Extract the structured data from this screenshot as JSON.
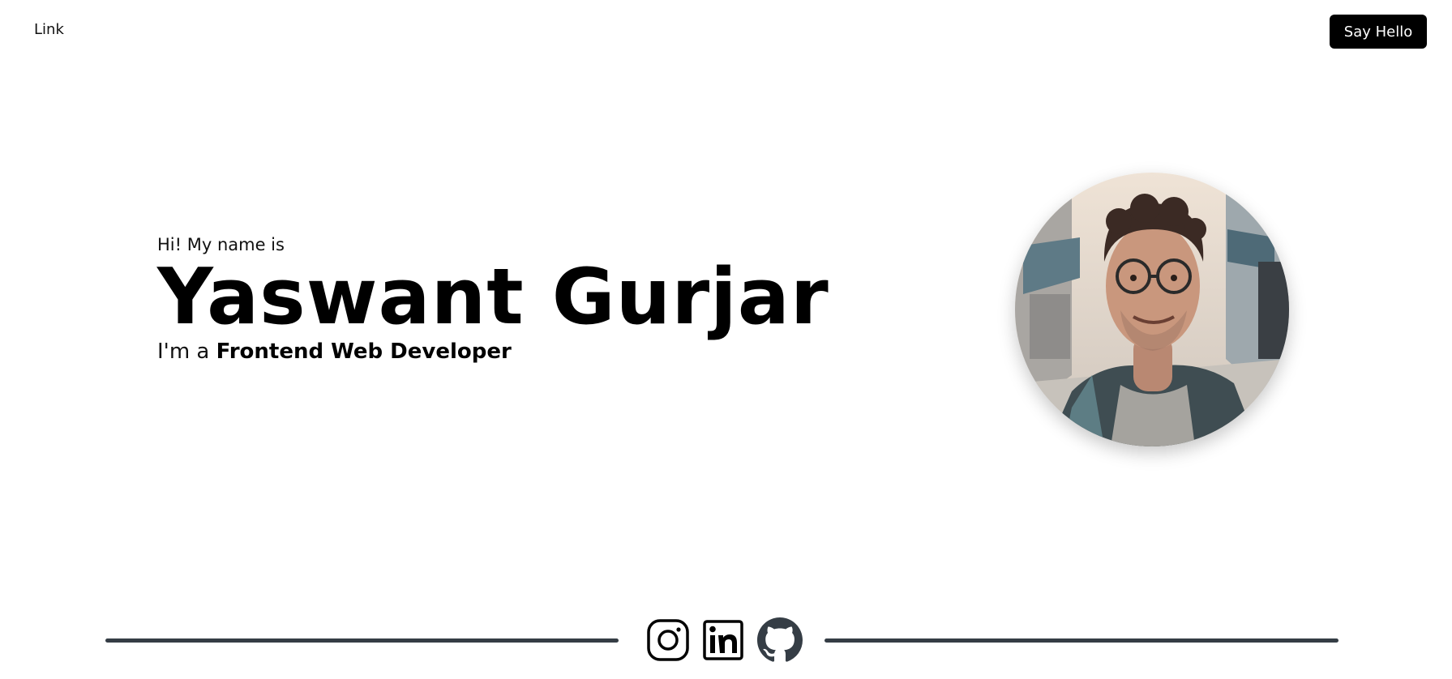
{
  "nav": {
    "link_label": "Link",
    "cta_label": "Say Hello"
  },
  "hero": {
    "greeting": "Hi! My name is",
    "name": "Yaswant Gurjar",
    "role_prefix": "I'm a",
    "role": "Frontend Web Developer"
  },
  "avatar": {
    "icon": "portrait-illustration"
  },
  "socials": [
    {
      "icon": "instagram-icon"
    },
    {
      "icon": "linkedin-icon"
    },
    {
      "icon": "github-icon"
    }
  ],
  "colors": {
    "cta_bg": "#000000",
    "divider": "#353d45",
    "text": "#000000"
  }
}
